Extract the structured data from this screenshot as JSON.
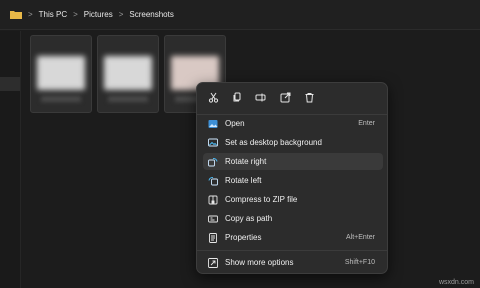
{
  "breadcrumb": [
    "This PC",
    "Pictures",
    "Screenshots"
  ],
  "breadcrumb_separator": ">",
  "icons": {
    "folder": "folder-icon",
    "cut": "scissors-icon",
    "copy": "copy-icon",
    "rename": "rename-icon",
    "share": "share-icon",
    "delete": "trash-icon"
  },
  "menu": {
    "items": [
      {
        "label": "Open",
        "shortcut": "Enter",
        "icon": "image-icon"
      },
      {
        "label": "Set as desktop background",
        "shortcut": "",
        "icon": "desktop-image-icon"
      },
      {
        "label": "Rotate right",
        "shortcut": "",
        "icon": "rotate-right-icon"
      },
      {
        "label": "Rotate left",
        "shortcut": "",
        "icon": "rotate-left-icon"
      },
      {
        "label": "Compress to ZIP file",
        "shortcut": "",
        "icon": "zip-icon"
      },
      {
        "label": "Copy as path",
        "shortcut": "",
        "icon": "path-icon"
      },
      {
        "label": "Properties",
        "shortcut": "Alt+Enter",
        "icon": "properties-icon"
      }
    ],
    "more": {
      "label": "Show more options",
      "shortcut": "Shift+F10",
      "icon": "more-options-icon"
    },
    "highlighted_index": 2
  },
  "watermark": "wsxdn.com",
  "colors": {
    "accent": "#4cc2ff",
    "menu_bg": "#2c2c2c",
    "folder": "#e8b848"
  }
}
